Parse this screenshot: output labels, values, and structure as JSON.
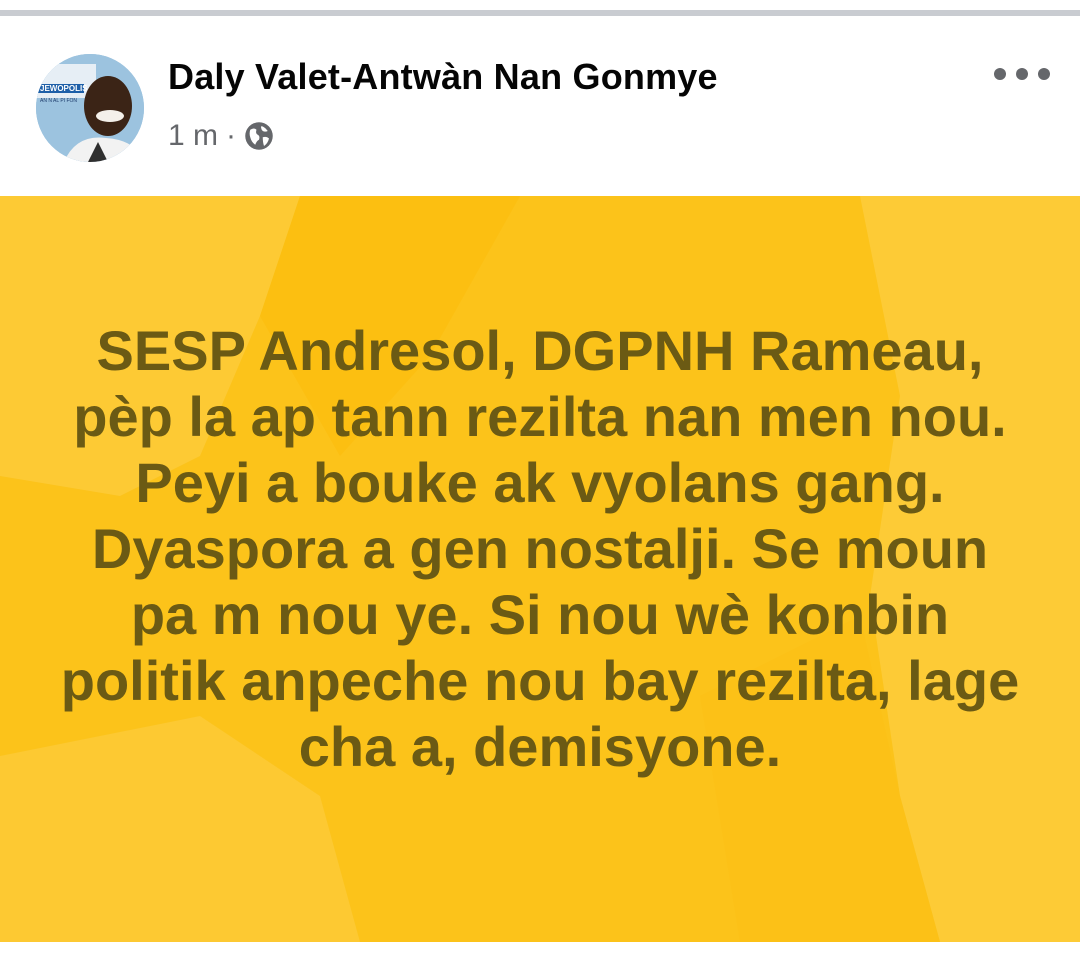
{
  "post": {
    "author": "Daly Valet-Antwàn Nan Gonmye",
    "timestamp": "1 m",
    "separator": "·",
    "privacy_icon": "globe-icon",
    "more_icon": "more-options-icon",
    "avatar_badge": "JEWOPOLIS",
    "avatar_caption": "AN N AL PI FON",
    "text": "SESP Andresol, DGPNH Rameau, pèp la ap tann rezilta nan men nou. Peyi a bouke ak vyolans gang. Dyaspora a gen nostalji. Se moun pa m nou ye. Si nou wè konbin politik anpeche nou bay rezilta, lage cha a, demisyone."
  },
  "colors": {
    "background_yellow": "#fcc31a",
    "text_color": "#6b5a14",
    "meta_gray": "#65676b"
  }
}
